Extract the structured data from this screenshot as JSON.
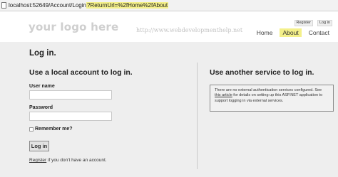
{
  "browser": {
    "url_base": "localhost:52649/Account/Login",
    "url_query": "?ReturnUrl=%2fHome%2fAbout"
  },
  "header": {
    "logo_text": "your logo here",
    "tagline": "http://www.webdevelopmenthelp.net",
    "register_label": "Register",
    "login_link_label": "Log in",
    "nav": [
      {
        "label": "Home"
      },
      {
        "label": "About"
      },
      {
        "label": "Contact"
      }
    ]
  },
  "main": {
    "title": "Log in.",
    "local_heading": "Use a local account to log in.",
    "username_label": "User name",
    "username_value": "",
    "password_label": "Password",
    "password_value": "",
    "remember_label": "Remember me?",
    "login_button": "Log in",
    "register_link": "Register",
    "register_suffix": " if you don't have an account.",
    "external_heading": "Use another service to log in.",
    "external_info_before": "There are no external authentication services configured. See ",
    "external_info_link": "this article",
    "external_info_after": " for details on setting up this ASP.NET application to support logging in via external services."
  },
  "colors": {
    "highlight": "#f4f08a",
    "main_background": "#eeeeee",
    "logo_gray": "#cfcfcf"
  }
}
